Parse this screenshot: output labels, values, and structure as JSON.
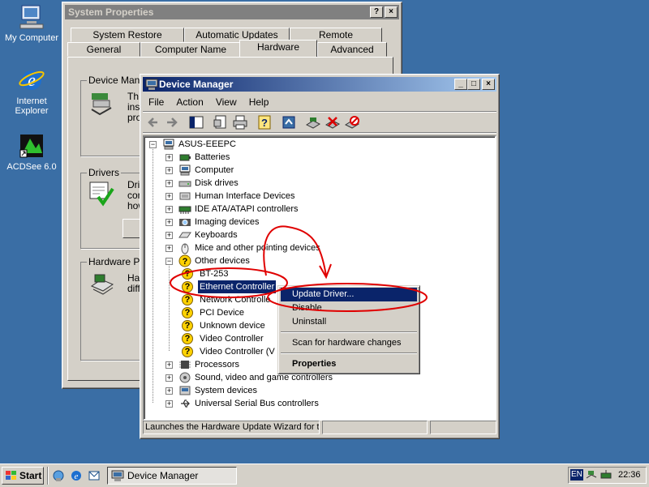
{
  "desktop": {
    "icons": [
      {
        "label": "My Computer",
        "icon": "my-computer-icon"
      },
      {
        "label": "Internet Explorer",
        "icon": "internet-explorer-icon"
      },
      {
        "label": "ACDSee 6.0",
        "icon": "acdsee-icon"
      }
    ]
  },
  "system_properties": {
    "title": "System Properties",
    "help_btn": "?",
    "close_btn": "×",
    "tabs_top": [
      "System Restore",
      "Automatic Updates",
      "Remote"
    ],
    "tabs_bottom": [
      "General",
      "Computer Name",
      "Hardware",
      "Advanced"
    ],
    "groups": [
      {
        "label": "Device Manag",
        "text1": "Th",
        "text2": "ins",
        "text3": "pro"
      },
      {
        "label": "Drivers",
        "text1": "Dri",
        "text2": "con",
        "text3": "how"
      },
      {
        "label": "Hardware Pro",
        "text1": "Ha",
        "text2": "diff"
      }
    ]
  },
  "device_manager": {
    "title": "Device Manager",
    "min_btn": "_",
    "max_btn": "□",
    "close_btn": "×",
    "menu": [
      "File",
      "Action",
      "View",
      "Help"
    ],
    "toolbar_icons": [
      "back-icon",
      "forward-icon",
      "show-hide-console-tree-icon",
      "properties-icon",
      "print-icon",
      "help-icon",
      "update-driver-icon",
      "scan-hardware-icon",
      "uninstall-icon",
      "disable-icon"
    ],
    "tree": {
      "root": "ASUS-EEEPC",
      "categories": [
        {
          "label": "Batteries",
          "icon": "battery-icon"
        },
        {
          "label": "Computer",
          "icon": "computer-icon"
        },
        {
          "label": "Disk drives",
          "icon": "disk-drive-icon"
        },
        {
          "label": "Human Interface Devices",
          "icon": "hid-icon"
        },
        {
          "label": "IDE ATA/ATAPI controllers",
          "icon": "ide-controller-icon"
        },
        {
          "label": "Imaging devices",
          "icon": "imaging-device-icon"
        },
        {
          "label": "Keyboards",
          "icon": "keyboard-icon"
        },
        {
          "label": "Mice and other pointing devices",
          "icon": "mouse-icon"
        },
        {
          "label": "Other devices",
          "icon": "other-devices-icon"
        }
      ],
      "other_devices": [
        "BT-253",
        "Ethernet Controller",
        "Network Controlle",
        "PCI Device",
        "Unknown device",
        "Video Controller",
        "Video Controller (V"
      ],
      "categories_after": [
        {
          "label": "Processors",
          "icon": "processor-icon"
        },
        {
          "label": "Sound, video and game controllers",
          "icon": "sound-icon"
        },
        {
          "label": "System devices",
          "icon": "system-devices-icon"
        },
        {
          "label": "Universal Serial Bus controllers",
          "icon": "usb-icon"
        }
      ]
    },
    "status_text": "Launches the Hardware Update Wizard for th"
  },
  "context_menu": {
    "items": [
      "Update Driver...",
      "Disable",
      "Uninstall",
      "Scan for hardware changes",
      "Properties"
    ]
  },
  "taskbar": {
    "start_label": "Start",
    "task_label": "Device Manager",
    "lang": "EN",
    "clock": "22:36"
  },
  "colors": {
    "desktop": "#3a6ea5",
    "title_active": "#0a246a",
    "selection": "#0a246a",
    "annotation": "#e00000"
  }
}
